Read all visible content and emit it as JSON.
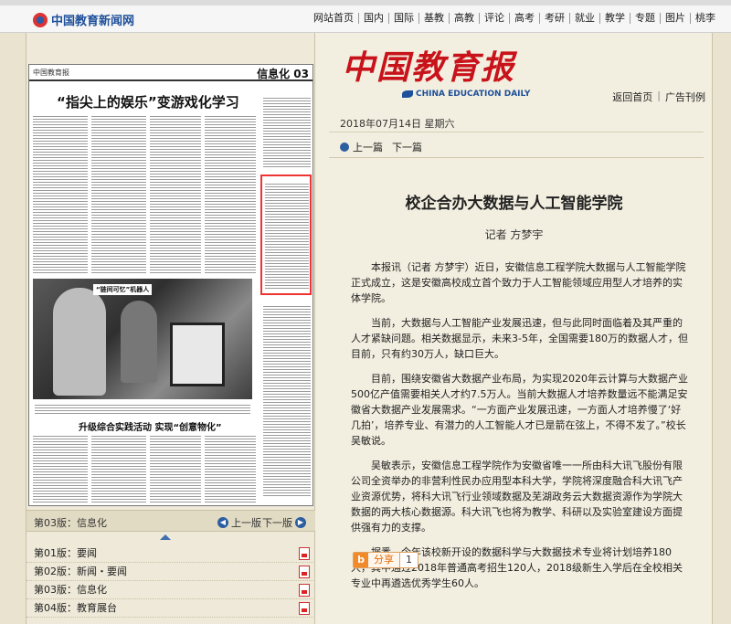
{
  "site": {
    "logo_text": "中国教育新闻网",
    "nav": [
      "网站首页",
      "国内",
      "国际",
      "基教",
      "高教",
      "评论",
      "高考",
      "考研",
      "就业",
      "教学",
      "专题",
      "图片",
      "桃李"
    ]
  },
  "newspaper": {
    "masthead_cn": "中国教育报",
    "masthead_en": "CHINA EDUCATION DAILY",
    "links": [
      "返回首页",
      "广告刊例"
    ],
    "date": "2018年07月14日 星期六",
    "prev_article": "上一篇",
    "next_article": "下一篇"
  },
  "page_image": {
    "section": "信息化 03",
    "headline": "“指尖上的娱乐”变游戏化学习",
    "sub_headline": "“链间可忆”机器人",
    "headline2": "升级综合实践活动 实现“创意物化”"
  },
  "edition_bar": {
    "current": "第03版：信息化",
    "prev": "上一版",
    "next": "下一版"
  },
  "editions": [
    {
      "label": "第01版：要闻"
    },
    {
      "label": "第02版：新闻・要闻"
    },
    {
      "label": "第03版：信息化"
    },
    {
      "label": "第04版：教育展台"
    }
  ],
  "article": {
    "title": "校企合办大数据与人工智能学院",
    "author": "记者 方梦宇",
    "paragraphs": [
      "本报讯（记者 方梦宇）近日，安徽信息工程学院大数据与人工智能学院正式成立，这是安徽高校成立首个致力于人工智能领域应用型人才培养的实体学院。",
      "当前，大数据与人工智能产业发展迅速，但与此同时面临着及其严重的人才紧缺问题。相关数据显示，未来3-5年，全国需要180万的数据人才，但目前，只有约30万人，缺口巨大。",
      "目前，围绕安徽省大数据产业布局，为实现2020年云计算与大数据产业500亿产值需要相关人才约7.5万人。当前大数据人才培养数量远不能满足安徽省大数据产业发展需求。“一方面产业发展迅速，一方面人才培养慢了‘好几拍’，培养专业、有潜力的人工智能人才已是箭在弦上，不得不发了。”校长吴敏说。",
      "吴敏表示，安徽信息工程学院作为安徽省唯一一所由科大讯飞股份有限公司全资举办的非营利性民办应用型本科大学，学院将深度融合科大讯飞产业资源优势，将科大讯飞行业领域数据及芜湖政务云大数据资源作为学院大数据的两大核心数据源。科大讯飞也将为教学、科研以及实验室建设方面提供强有力的支撑。",
      "据悉，今年该校新开设的数据科学与大数据技术专业将计划培养180人，其中通过2018年普通高考招生120人，2018级新生入学后在全校相关专业中再遴选优秀学生60人。"
    ],
    "share_label": "分享",
    "share_count": "1"
  },
  "colors": {
    "brand_red": "#c8131b",
    "brand_blue": "#1d4f9a",
    "highlight_box": "#e33333"
  }
}
